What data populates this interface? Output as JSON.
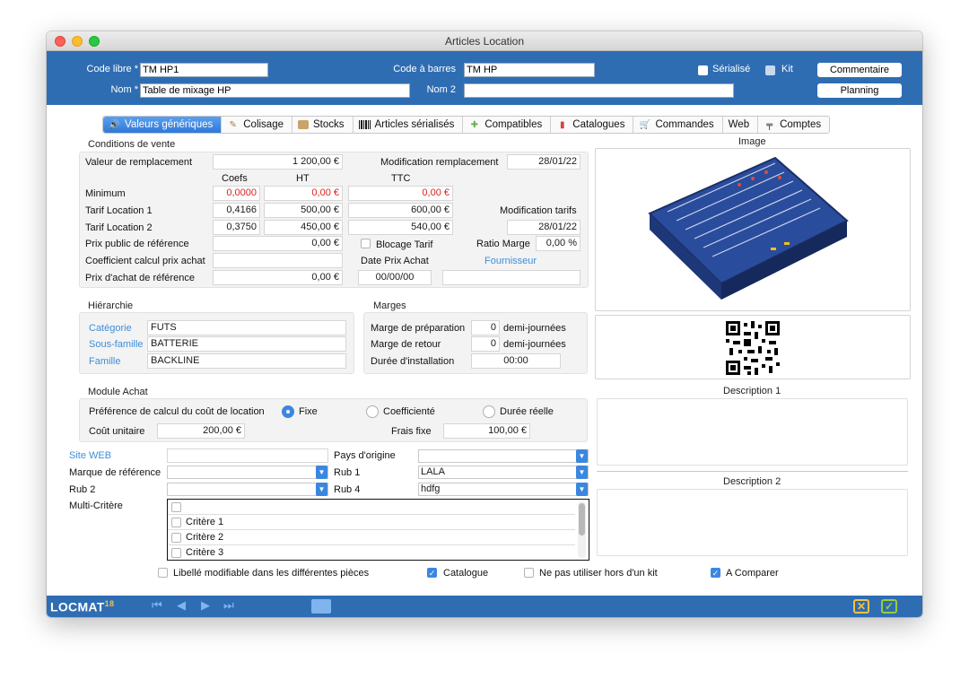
{
  "window": {
    "title": "Articles Location"
  },
  "header": {
    "code_libre_label": "Code libre *",
    "code_libre_value": "TM HP1",
    "code_barres_label": "Code à barres",
    "code_barres_value": "TM HP",
    "serialise_label": "Sérialisé",
    "kit_label": "Kit",
    "commentaire_button": "Commentaire",
    "nom_label": "Nom *",
    "nom_value": "Table de mixage HP",
    "nom2_label": "Nom 2",
    "nom2_value": "",
    "planning_button": "Planning"
  },
  "tabs": [
    {
      "label": "Valeurs génériques",
      "icon": "sound-icon",
      "active": true
    },
    {
      "label": "Colisage",
      "icon": "box-label-icon"
    },
    {
      "label": "Stocks",
      "icon": "crate-icon"
    },
    {
      "label": "Articles sérialisés",
      "icon": "barcode-icon"
    },
    {
      "label": "Compatibles",
      "icon": "puzzle-icon"
    },
    {
      "label": "Catalogues",
      "icon": "books-icon"
    },
    {
      "label": "Commandes",
      "icon": "cart-icon"
    },
    {
      "label": "Web",
      "icon": ""
    },
    {
      "label": "Comptes",
      "icon": "accounting-icon"
    }
  ],
  "conditions": {
    "title": "Conditions de vente",
    "valeur_remplacement_label": "Valeur de remplacement",
    "valeur_remplacement_value": "1 200,00 €",
    "modif_remplacement_label": "Modification remplacement",
    "modif_remplacement_value": "28/01/22",
    "col_coefs": "Coefs",
    "col_ht": "HT",
    "col_ttc": "TTC",
    "minimum_label": "Minimum",
    "minimum_coef": "0,0000",
    "minimum_ht": "0,00 €",
    "minimum_ttc": "0,00 €",
    "tarif1_label": "Tarif Location 1",
    "tarif1_coef": "0,4166",
    "tarif1_ht": "500,00 €",
    "tarif1_ttc": "600,00 €",
    "modif_tarifs_label": "Modification tarifs",
    "modif_tarifs_value": "28/01/22",
    "tarif2_label": "Tarif Location 2",
    "tarif2_coef": "0,3750",
    "tarif2_ht": "450,00 €",
    "tarif2_ttc": "540,00 €",
    "prix_public_label": "Prix public de référence",
    "prix_public_value": "0,00 €",
    "blocage_tarif_label": "Blocage Tarif",
    "ratio_marge_label": "Ratio Marge",
    "ratio_marge_value": "0,00 %",
    "coef_calcul_label": "Coefficient calcul prix achat",
    "coef_calcul_value": "",
    "date_prix_achat_label": "Date Prix Achat",
    "fournisseur_label": "Fournisseur",
    "prix_achat_label": "Prix d'achat de référence",
    "prix_achat_value": "0,00 €",
    "date_prix_achat_value": "00/00/00",
    "fournisseur_value": ""
  },
  "image": {
    "title": "Image",
    "alt": "audio mixer"
  },
  "hierarchie": {
    "title": "Hiérarchie",
    "categorie_label": "Catégorie",
    "categorie_value": "FUTS",
    "sous_famille_label": "Sous-famille",
    "sous_famille_value": "BATTERIE",
    "famille_label": "Famille",
    "famille_value": "BACKLINE"
  },
  "marges": {
    "title": "Marges",
    "preparation_label": "Marge de préparation",
    "preparation_value": "0",
    "retour_label": "Marge de retour",
    "retour_value": "0",
    "unit": "demi-journées",
    "installation_label": "Durée d'installation",
    "installation_value": "00:00"
  },
  "module_achat": {
    "title": "Module Achat",
    "preference_label": "Préférence de calcul du coût de location",
    "option_fixe": "Fixe",
    "option_coef": "Coefficienté",
    "option_reelle": "Durée réelle",
    "cout_unitaire_label": "Coût unitaire",
    "cout_unitaire_value": "200,00 €",
    "frais_fixe_label": "Frais fixe",
    "frais_fixe_value": "100,00 €"
  },
  "misc": {
    "site_web_label": "Site WEB",
    "site_web_value": "",
    "pays_label": "Pays d'origine",
    "pays_value": "",
    "marque_label": "Marque de référence",
    "marque_value": "",
    "rub1_label": "Rub 1",
    "rub1_value": "LALA",
    "rub2_label": "Rub 2",
    "rub2_value": "",
    "rub4_label": "Rub 4",
    "rub4_value": "hdfg",
    "multi_label": "Multi-Critère",
    "criteres": [
      "",
      "Critère 1",
      "Critère 2",
      "Critère 3"
    ]
  },
  "descriptions": {
    "d1_title": "Description 1",
    "d2_title": "Description 2"
  },
  "bottom_checks": {
    "libelle": "Libellé modifiable dans les différentes pièces",
    "catalogue": "Catalogue",
    "hors_kit": "Ne pas utiliser hors d'un kit",
    "comparer": "A Comparer"
  },
  "footer": {
    "logo": "LOCMAT",
    "version": "18"
  },
  "colors": {
    "header_blue": "#2f6db3",
    "accent": "#3b87e0",
    "link": "#3d8fd8",
    "red": "#e02020"
  }
}
